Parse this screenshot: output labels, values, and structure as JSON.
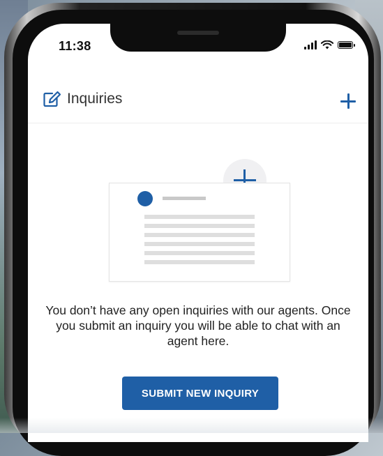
{
  "status_bar": {
    "time": "11:38",
    "signal_icon": "cellular-signal-icon",
    "wifi_icon": "wifi-icon",
    "battery_icon": "battery-icon"
  },
  "header": {
    "title": "Inquiries",
    "title_icon": "edit-icon",
    "add_icon": "plus-icon"
  },
  "empty_state": {
    "illustration_icon": "plus-icon",
    "message": "You don’t have any open inquiries with our agents. Once you submit an inquiry you will be able to chat with an agent here.",
    "button_label": "SUBMIT NEW INQUIRY"
  },
  "colors": {
    "accent": "#1f5fa6",
    "text": "#222222",
    "background": "#ffffff"
  }
}
